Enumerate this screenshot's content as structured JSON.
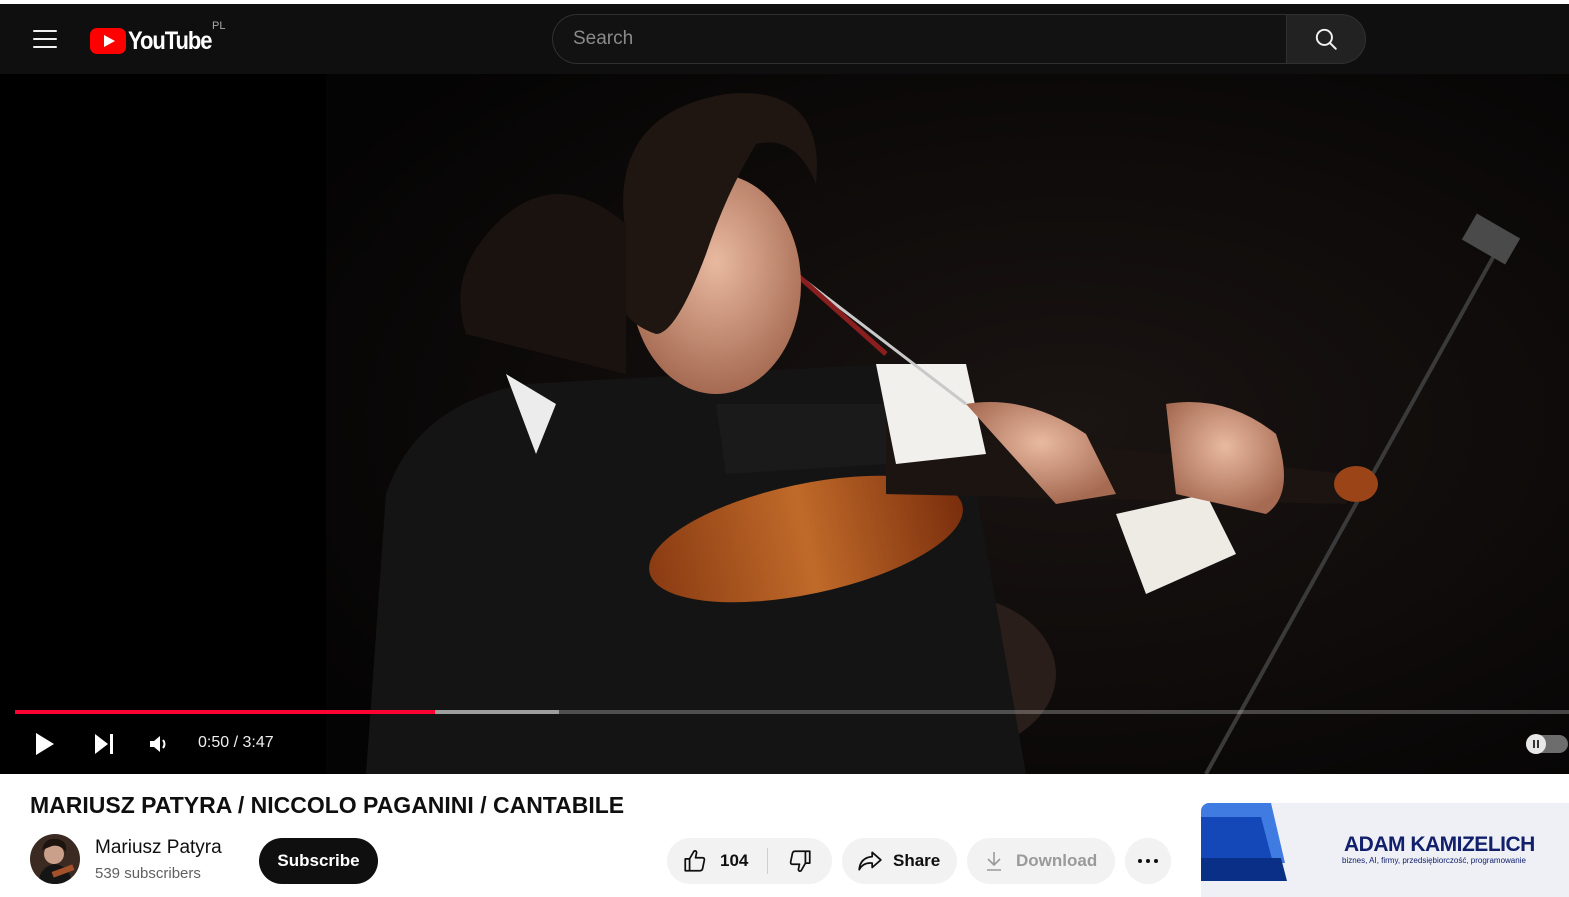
{
  "header": {
    "logo_text": "YouTube",
    "country_code": "PL",
    "search_placeholder": "Search"
  },
  "player": {
    "current_time": "0:50",
    "duration": "3:47",
    "time_display": "0:50 / 3:47",
    "played_fraction": 0.27,
    "buffered_fraction": 0.35,
    "autoplay_on": false
  },
  "video": {
    "title": "MARIUSZ PATYRA / NICCOLO PAGANINI / CANTABILE"
  },
  "channel": {
    "name": "Mariusz Patyra",
    "subscribers": "539 subscribers",
    "subscribe_label": "Subscribe"
  },
  "actions": {
    "like_count": "104",
    "share_label": "Share",
    "download_label": "Download"
  },
  "ad": {
    "brand": "ADAM KAMIZELICH",
    "tagline": "biznes, AI, firmy, przedsiębiorczość, programowanie"
  },
  "colors": {
    "accent": "#ff0033",
    "masthead": "#0f0f0f",
    "ad_brand": "#12206b"
  }
}
